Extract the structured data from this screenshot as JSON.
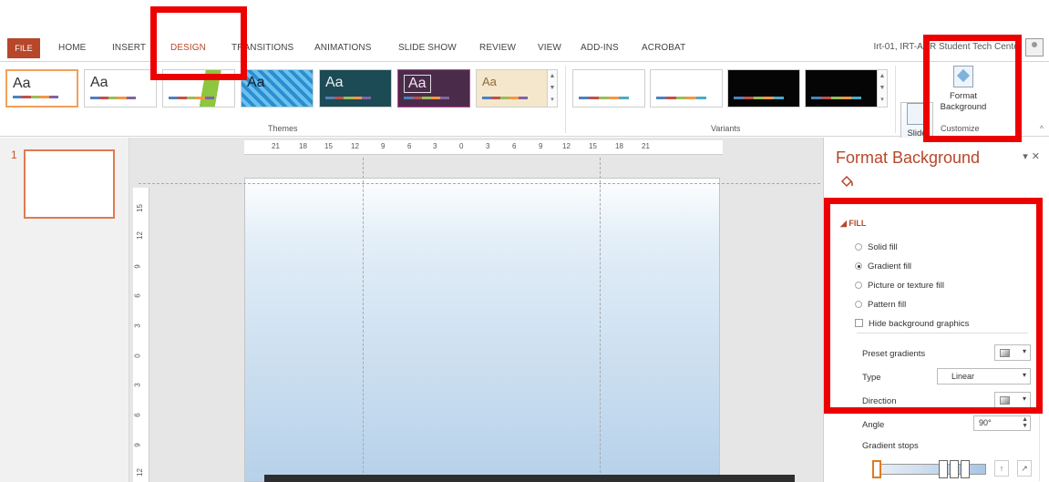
{
  "tabs": [
    "FILE",
    "HOME",
    "INSERT",
    "DESIGN",
    "TRANSITIONS",
    "ANIMATIONS",
    "SLIDE SHOW",
    "REVIEW",
    "VIEW",
    "ADD-INS",
    "ACROBAT"
  ],
  "active_tab": "DESIGN",
  "account": "Irt-01, IRT-ACR Student Tech Center",
  "themes": [
    "Aa",
    "Aa",
    "",
    "Aa",
    "Aa",
    "Aa",
    "Aa"
  ],
  "groups": {
    "themes": "Themes",
    "variants": "Variants",
    "customize": "Customize"
  },
  "buttons": {
    "slide_size": "Slide Size",
    "format_background": "Format Background"
  },
  "slide_number": "1",
  "hruler": [
    "21",
    "18",
    "15",
    "12",
    "9",
    "6",
    "3",
    "0",
    "3",
    "6",
    "9",
    "12",
    "15",
    "18",
    "21"
  ],
  "vruler": [
    "15",
    "12",
    "9",
    "6",
    "3",
    "0",
    "3",
    "6",
    "9",
    "12"
  ],
  "pane": {
    "title": "Format Background",
    "fill_header": "FILL",
    "options": [
      {
        "label": "Solid fill",
        "checked": false
      },
      {
        "label": "Gradient fill",
        "checked": true
      },
      {
        "label": "Picture or texture fill",
        "checked": false
      },
      {
        "label": "Pattern fill",
        "checked": false
      }
    ],
    "hide_bg": "Hide background graphics",
    "preset_label": "Preset gradients",
    "type_label": "Type",
    "type_value": "Linear",
    "direction_label": "Direction",
    "angle_label": "Angle",
    "angle_value": "90°",
    "stops_label": "Gradient stops"
  },
  "colors": {
    "accent": "#b7472a",
    "highlight": "#ec0000"
  }
}
